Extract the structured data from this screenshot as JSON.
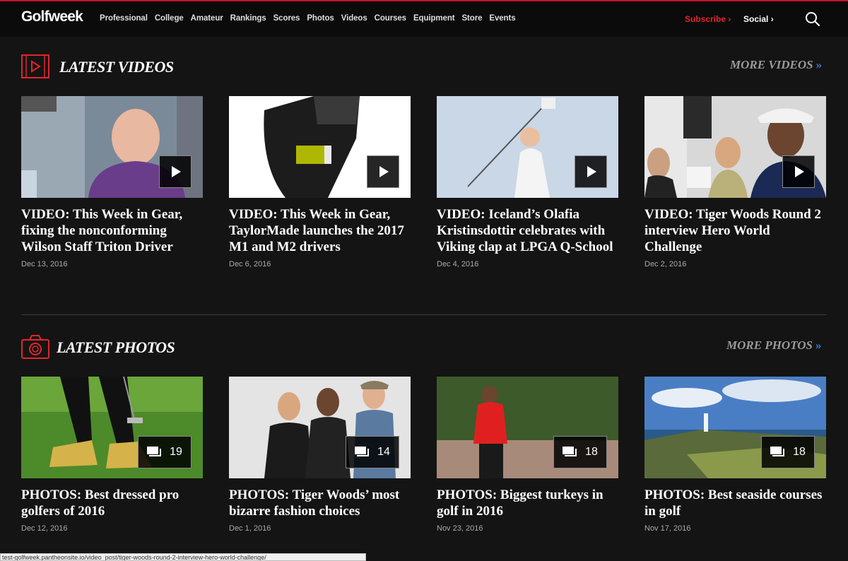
{
  "brand": {
    "logo": "Golfweek",
    "accent": "#e0262b",
    "link_blue": "#3a7bd5"
  },
  "nav": {
    "items": [
      "Professional",
      "College",
      "Amateur",
      "Rankings",
      "Scores",
      "Photos",
      "Videos",
      "Courses",
      "Equipment",
      "Store",
      "Events"
    ],
    "subscribe": "Subscribe",
    "social": "Social"
  },
  "videos": {
    "title": "LATEST VIDEOS",
    "more": "MORE VIDEOS",
    "items": [
      {
        "title": "VIDEO: This Week in Gear, fixing the nonconforming Wilson Staff Triton Driver",
        "date": "Dec 13, 2016"
      },
      {
        "title": "VIDEO: This Week in Gear, TaylorMade launches the 2017 M1 and M2 drivers",
        "date": "Dec 6, 2016"
      },
      {
        "title": "VIDEO: Iceland’s Olafia Kristinsdottir celebrates with Viking clap at LPGA Q-School",
        "date": "Dec 4, 2016"
      },
      {
        "title": "VIDEO: Tiger Woods Round 2 interview Hero World Challenge",
        "date": "Dec 2, 2016"
      }
    ]
  },
  "photos": {
    "title": "LATEST PHOTOS",
    "more": "MORE PHOTOS",
    "items": [
      {
        "title": "PHOTOS: Best dressed pro golfers of 2016",
        "date": "Dec 12, 2016",
        "count": "19"
      },
      {
        "title": "PHOTOS: Tiger Woods’ most bizarre fashion choices",
        "date": "Dec 1, 2016",
        "count": "14"
      },
      {
        "title": "PHOTOS: Biggest turkeys in golf in 2016",
        "date": "Nov 23, 2016",
        "count": "18"
      },
      {
        "title": "PHOTOS: Best seaside courses in golf",
        "date": "Nov 17, 2016",
        "count": "18"
      }
    ]
  },
  "status_url": "test-golfweek.pantheonsite.io/video_post/tiger-woods-round-2-interview-hero-world-challenge/"
}
